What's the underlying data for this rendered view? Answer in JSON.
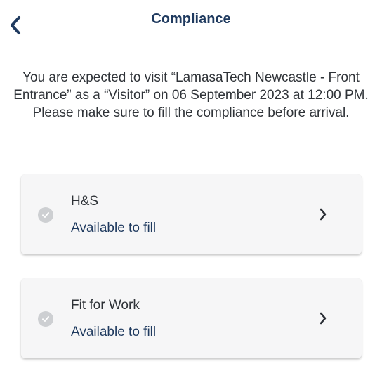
{
  "header": {
    "title": "Compliance",
    "back_icon": "chevron-left-icon"
  },
  "intro": {
    "text": "You are expected to visit “LamasaTech Newcastle - Front Entrance” as a “Visitor” on 06 September 2023 at 12:00 PM. Please make sure to fill the compliance before arrival."
  },
  "compliance_items": [
    {
      "name": "H&S",
      "status": "Available to fill"
    },
    {
      "name": "Fit for Work",
      "status": "Available to fill"
    }
  ],
  "colors": {
    "accent": "#1f3a5f",
    "card_bg": "#f6f6f7",
    "status_icon": "#cdcfd2"
  }
}
